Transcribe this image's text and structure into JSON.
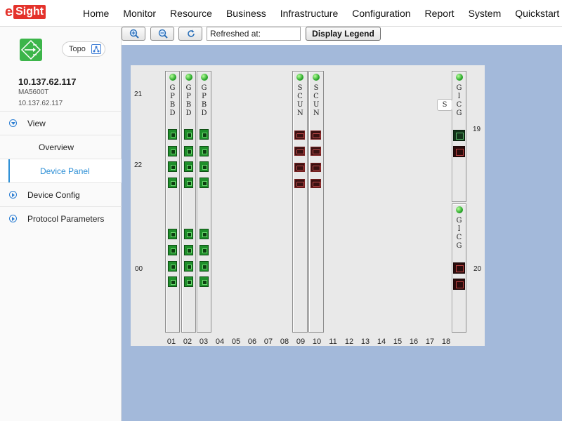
{
  "brand": {
    "prefix": "e",
    "box": "Sight"
  },
  "nav": [
    "Home",
    "Monitor",
    "Resource",
    "Business",
    "Infrastructure",
    "Configuration",
    "Report",
    "System",
    "Quickstart"
  ],
  "sidebar": {
    "topo_label": "Topo",
    "device_name": "10.137.62.117",
    "device_model": "MA5600T",
    "device_ip": "10.137.62.117",
    "menu": [
      {
        "label": "View",
        "type": "group",
        "expanded": true
      },
      {
        "label": "Overview",
        "type": "sub"
      },
      {
        "label": "Device Panel",
        "type": "sub",
        "active": true
      },
      {
        "label": "Device Config",
        "type": "group"
      },
      {
        "label": "Protocol Parameters",
        "type": "group"
      }
    ]
  },
  "toolbar": {
    "zoom_in_icon": "zoom-in-icon",
    "zoom_out_icon": "zoom-out-icon",
    "reset_icon": "refresh-icon",
    "refreshed_value": "Refreshed at:",
    "legend_label": "Display Legend"
  },
  "panel": {
    "row_labels": [
      "21",
      "22",
      "00",
      "19",
      "20"
    ],
    "slots": [
      "01",
      "02",
      "03",
      "04",
      "05",
      "06",
      "07",
      "08",
      "09",
      "10",
      "11",
      "12",
      "13",
      "14",
      "15",
      "16",
      "17",
      "18"
    ],
    "tooltip": "S",
    "boards": [
      {
        "name": "G P B D",
        "slot": "01"
      },
      {
        "name": "G P B D",
        "slot": "02"
      },
      {
        "name": "G P B D",
        "slot": "03"
      },
      {
        "name": "S C U N",
        "slot": "09"
      },
      {
        "name": "S C U N",
        "slot": "10"
      },
      {
        "name": "G I C G",
        "slot": "19"
      },
      {
        "name": "G I C G",
        "slot": "20"
      }
    ],
    "colors": {
      "panel": "#e9e9e9",
      "canvas": "#a3b9da",
      "port_up": "#1f8f2b",
      "port_down": "#3a1212"
    }
  }
}
